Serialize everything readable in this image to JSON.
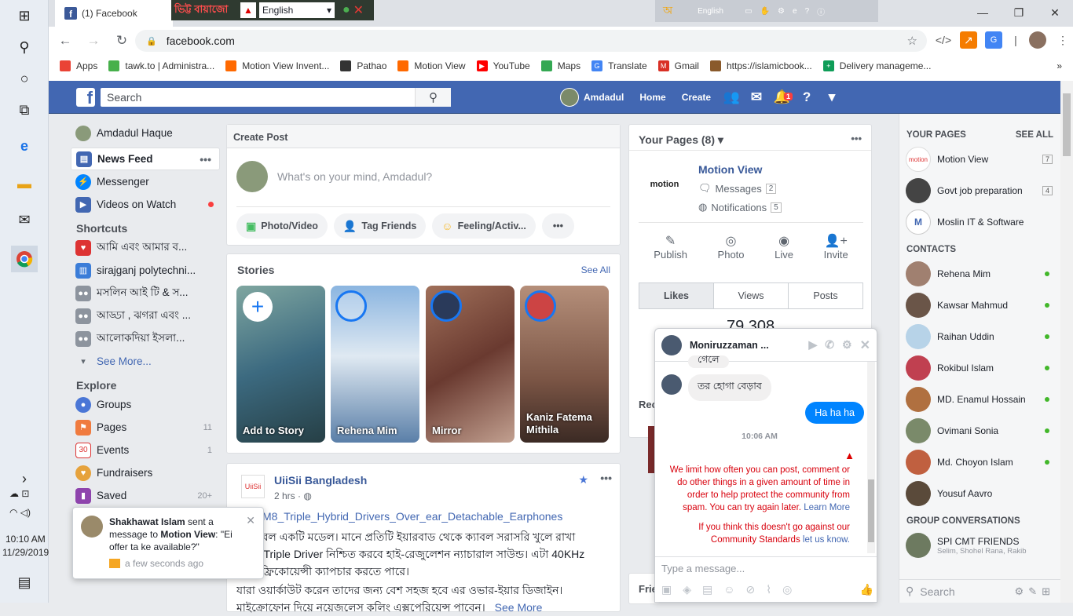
{
  "taskbar": {
    "time": "10:10 AM",
    "date": "11/29/2019"
  },
  "browser": {
    "tab_title": "(1) Facebook",
    "banner_label": "ভিট্ট বায়াজো",
    "banner_language": "English",
    "tools_language": "English",
    "url": "facebook.com",
    "bookmarks": [
      {
        "label": "Apps",
        "color": "#ea4335"
      },
      {
        "label": "tawk.to | Administra...",
        "color": "#47b04b"
      },
      {
        "label": "Motion View Invent...",
        "color": "#ff6900"
      },
      {
        "label": "Pathao",
        "color": "#333333"
      },
      {
        "label": "Motion View",
        "color": "#ff6900"
      },
      {
        "label": "YouTube",
        "color": "#ff0000"
      },
      {
        "label": "Maps",
        "color": "#34a853"
      },
      {
        "label": "Translate",
        "color": "#4285f4"
      },
      {
        "label": "Gmail",
        "color": "#d93025"
      },
      {
        "label": "https://islamicbook...",
        "color": "#8a5a2b"
      },
      {
        "label": "Delivery manageme...",
        "color": "#0f9d58"
      }
    ]
  },
  "fb": {
    "search_placeholder": "Search",
    "user_name": "Amdadul",
    "home": "Home",
    "create": "Create",
    "notif_count": "1"
  },
  "left_nav": {
    "profile": "Amdadul Haque",
    "items": [
      {
        "label": "News Feed",
        "more": "•••"
      },
      {
        "label": "Messenger"
      },
      {
        "label": "Videos on Watch"
      }
    ],
    "shortcuts_title": "Shortcuts",
    "shortcuts": [
      "আমি এবং আমার ব...",
      "sirajganj polytechni...",
      "মসলিন আই টি & স...",
      "আড্ডা , ঝগরা এবং ...",
      "আলোকদিয়া ইসলা..."
    ],
    "see_more": "See More...",
    "explore_title": "Explore",
    "explore": [
      {
        "label": "Groups",
        "count": ""
      },
      {
        "label": "Pages",
        "count": "11"
      },
      {
        "label": "Events",
        "count": "1"
      },
      {
        "label": "Fundraisers",
        "count": ""
      },
      {
        "label": "Saved",
        "count": "20+"
      }
    ]
  },
  "create_post": {
    "title": "Create Post",
    "placeholder": "What's on your mind, Amdadul?",
    "photo": "Photo/Video",
    "tag": "Tag Friends",
    "feeling": "Feeling/Activ...",
    "more": "•••"
  },
  "stories": {
    "title": "Stories",
    "see_all": "See All",
    "items": [
      "Add to Story",
      "Rehena Mim",
      "Mirror",
      "Kaniz Fatema Mithila"
    ]
  },
  "post": {
    "page": "UiiSii Bangladesh",
    "time": "2 hrs · ",
    "link": "i_CM8_Triple_Hybrid_Drivers_Over_ear_Detachable_Earphones",
    "lines": [
      "ডাবলবল একটি মডেল। মানে প্রতিটি ইয়ারবাড থেকে ক্যাবল সরাসরি খুলে রাখা",
      "যাবে। Triple Driver নিশ্চিত করবে হাই-রেজুলেশন ন্যাচারাল সাউন্ড। এটা 40KHz",
      "পর্যন্ত ফ্রিকোয়েন্সী ক্যাপচার করতে পারে।",
      "যারা ওয়ার্কাউট করেন তাদের জন্য বেশ সহজ হবে এর ওভার-ইয়ার ডিজাইন।",
      "মাইক্রোফোন দিয়ে নয়েজলেস কলিং এক্সপেরিয়েন্স পাবেন।"
    ],
    "see_more": "See More"
  },
  "pages_card": {
    "title": "Your Pages (8)",
    "more": "•••",
    "page_name": "Motion View",
    "logo_text": "motion",
    "messages": "Messages",
    "messages_count": "2",
    "notifications": "Notifications",
    "notifications_count": "5",
    "actions": [
      "Publish",
      "Photo",
      "Live",
      "Invite"
    ],
    "tabs": [
      "Likes",
      "Views",
      "Posts"
    ],
    "likes": "79,308",
    "rec_partial": "Rec",
    "fri_partial": "Frie"
  },
  "chat": {
    "name": "Moniruzzaman ...",
    "partial_msg": "গেলে",
    "msg_in": "তর হোগা বেড়াব",
    "msg_out": "Ha ha ha",
    "time": "10:06 AM",
    "warning": "We limit how often you can post, comment or do other things in a given amount of time in order to help protect the community from spam. You can try again later.",
    "learn_more": "Learn More",
    "warning2": "If you think this doesn't go against our Community Standards",
    "let_us_know": "let us know.",
    "input_placeholder": "Type a message..."
  },
  "notification": {
    "sender": "Shakhawat Islam",
    "text_mid": " sent a message to ",
    "page": "Motion View",
    "text_end": ": \"Ei offer ta ke available?\"",
    "time": "a few seconds ago"
  },
  "right_panel": {
    "your_pages": "YOUR PAGES",
    "see_all": "SEE ALL",
    "pages": [
      {
        "name": "Motion View",
        "count": "7"
      },
      {
        "name": "Govt job preparation",
        "count": "4"
      },
      {
        "name": "Moslin IT & Software",
        "count": ""
      }
    ],
    "contacts_title": "CONTACTS",
    "contacts": [
      "Rehena Mim",
      "Kawsar Mahmud",
      "Raihan Uddin",
      "Rokibul Islam",
      "MD. Enamul Hossain",
      "Ovimani Sonia",
      "Md. Choyon Islam",
      "Yousuf Aavro"
    ],
    "group_title": "GROUP CONVERSATIONS",
    "group_name": "SPI CMT FRIENDS",
    "group_members": "Selim, Shohel Rana, Rakib",
    "search_placeholder": "Search"
  }
}
